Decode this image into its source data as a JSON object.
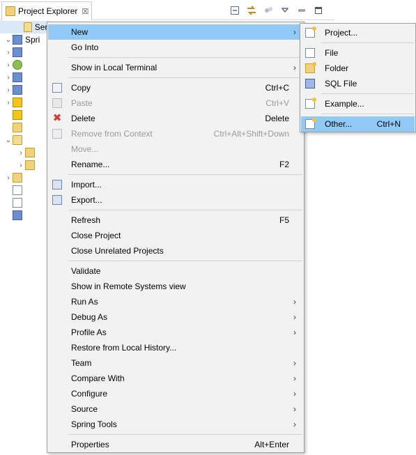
{
  "view": {
    "title": "Project Explorer",
    "close_glyph": "☒"
  },
  "tree": {
    "items": [
      {
        "label": "Serv",
        "icon": "folder-open-icon",
        "twisty": ""
      },
      {
        "label": "Spri",
        "icon": "maven-project-icon",
        "twisty": "⌄"
      },
      {
        "label": "",
        "icon": "jre-library-icon",
        "twisty": "›"
      },
      {
        "label": "",
        "icon": "spring-icon",
        "twisty": "›"
      },
      {
        "label": "",
        "icon": "deploy-icon",
        "twisty": "›"
      },
      {
        "label": "",
        "icon": "java-resources-icon",
        "twisty": "›"
      },
      {
        "label": "",
        "icon": "libraries-icon",
        "twisty": "›"
      },
      {
        "label": "",
        "icon": "warning-icon",
        "twisty": ""
      },
      {
        "label": "",
        "icon": "web-folder-icon",
        "twisty": ""
      },
      {
        "label": "",
        "icon": "src-folder-icon",
        "twisty": "⌄"
      },
      {
        "label": "",
        "icon": "folder-icon",
        "twisty": "›"
      },
      {
        "label": "",
        "icon": "folder-icon",
        "twisty": "›"
      },
      {
        "label": "",
        "icon": "folder-icon",
        "twisty": "›"
      },
      {
        "label": "",
        "icon": "file-icon",
        "twisty": ""
      },
      {
        "label": "",
        "icon": "settings-file-icon",
        "twisty": ""
      },
      {
        "label": "",
        "icon": "pom-file-icon",
        "twisty": ""
      }
    ]
  },
  "menu": {
    "items": [
      {
        "label": "New",
        "accel": "",
        "submenu": true,
        "highlight": true
      },
      {
        "label": "Go Into",
        "accel": ""
      },
      {
        "label": "Show in Local Terminal",
        "accel": "",
        "submenu": true
      },
      {
        "label": "Copy",
        "accel": "Ctrl+C",
        "icon": "copy-icon"
      },
      {
        "label": "Paste",
        "accel": "Ctrl+V",
        "icon": "paste-icon",
        "disabled": true
      },
      {
        "label": "Delete",
        "accel": "Delete",
        "icon": "delete-icon"
      },
      {
        "label": "Remove from Context",
        "accel": "Ctrl+Alt+Shift+Down",
        "icon": "remove-context-icon",
        "disabled": true
      },
      {
        "label": "Move...",
        "accel": "",
        "disabled": true
      },
      {
        "label": "Rename...",
        "accel": "F2"
      },
      {
        "label": "Import...",
        "accel": "",
        "icon": "import-icon"
      },
      {
        "label": "Export...",
        "accel": "",
        "icon": "export-icon"
      },
      {
        "label": "Refresh",
        "accel": "F5"
      },
      {
        "label": "Close Project",
        "accel": ""
      },
      {
        "label": "Close Unrelated Projects",
        "accel": ""
      },
      {
        "label": "Validate",
        "accel": ""
      },
      {
        "label": "Show in Remote Systems view",
        "accel": ""
      },
      {
        "label": "Run As",
        "accel": "",
        "submenu": true
      },
      {
        "label": "Debug As",
        "accel": "",
        "submenu": true
      },
      {
        "label": "Profile As",
        "accel": "",
        "submenu": true
      },
      {
        "label": "Restore from Local History...",
        "accel": ""
      },
      {
        "label": "Team",
        "accel": "",
        "submenu": true
      },
      {
        "label": "Compare With",
        "accel": "",
        "submenu": true
      },
      {
        "label": "Configure",
        "accel": "",
        "submenu": true
      },
      {
        "label": "Source",
        "accel": "",
        "submenu": true
      },
      {
        "label": "Spring Tools",
        "accel": "",
        "submenu": true
      },
      {
        "label": "Properties",
        "accel": "Alt+Enter"
      }
    ],
    "submenu_arrow": "›"
  },
  "submenu": {
    "items": [
      {
        "label": "Project...",
        "accel": "",
        "icon": "new-project-icon"
      },
      {
        "label": "File",
        "accel": "",
        "icon": "new-file-icon"
      },
      {
        "label": "Folder",
        "accel": "",
        "icon": "new-folder-icon"
      },
      {
        "label": "SQL File",
        "accel": "",
        "icon": "sql-file-icon"
      },
      {
        "label": "Example...",
        "accel": "",
        "icon": "new-example-icon"
      },
      {
        "label": "Other...",
        "accel": "Ctrl+N",
        "icon": "new-other-icon",
        "highlight": true
      }
    ]
  },
  "colors": {
    "highlight": "#91c9f7",
    "menu_bg": "#f2f2f2"
  }
}
